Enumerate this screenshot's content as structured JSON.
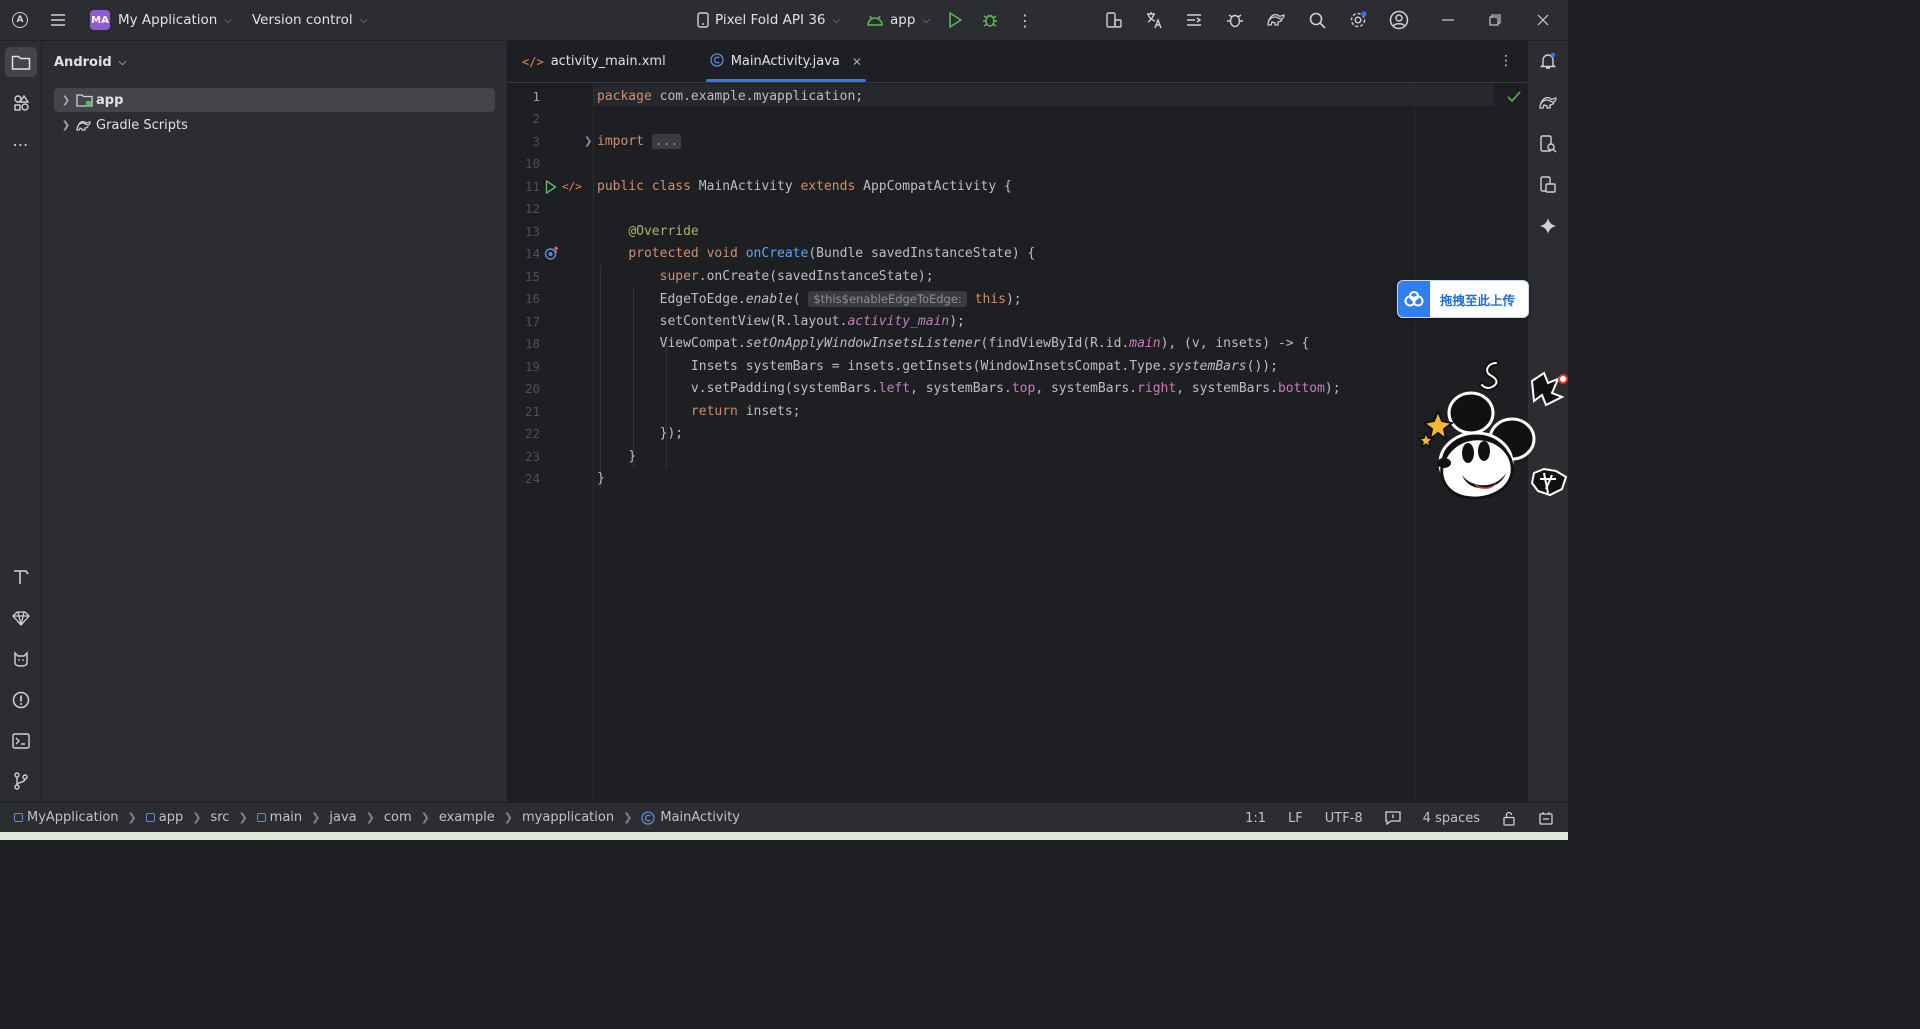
{
  "titlebar": {
    "project_badge": "MA",
    "project_name": "My Application",
    "vcs_label": "Version control",
    "device": "Pixel Fold API 36",
    "run_config": "app"
  },
  "project_panel": {
    "view_label": "Android",
    "tree": [
      {
        "label": "app"
      },
      {
        "label": "Gradle Scripts"
      }
    ]
  },
  "editor": {
    "tabs": [
      {
        "label": "activity_main.xml"
      },
      {
        "label": "MainActivity.java"
      }
    ],
    "line_numbers": [
      "1",
      "2",
      "3",
      "10",
      "11",
      "12",
      "13",
      "14",
      "15",
      "16",
      "17",
      "18",
      "19",
      "20",
      "21",
      "22",
      "23",
      "24"
    ],
    "code": {
      "l1a": "package",
      "l1b": " com.example.myapplication;",
      "l3a": "import",
      "l3b": "...",
      "l11a": "public class",
      "l11b": " MainActivity ",
      "l11c": "extends",
      "l11d": " AppCompatActivity {",
      "l13": "@Override",
      "l14a": "protected void",
      "l14b": "onCreate",
      "l14c": "(Bundle savedInstanceState) {",
      "l15a": "super",
      "l15b": ".onCreate(savedInstanceState);",
      "l16a": "EdgeToEdge.",
      "l16b": "enable",
      "l16c": "(",
      "l16hint": "$this$enableEdgeToEdge:",
      "l16d": "this",
      "l16e": ");",
      "l17a": "setContentView(R.layout.",
      "l17b": "activity_main",
      "l17c": ");",
      "l18a": "ViewCompat.",
      "l18b": "setOnApplyWindowInsetsListener",
      "l18c": "(findViewById(R.id.",
      "l18d": "main",
      "l18e": "), (v, insets) -> {",
      "l19a": "Insets systemBars = insets.getInsets(WindowInsetsCompat.Type.",
      "l19b": "systemBars",
      "l19c": "());",
      "l20a": "v.setPadding(systemBars.",
      "l20b": "left",
      "l20c": ", systemBars.",
      "l20d": "top",
      "l20e": ", systemBars.",
      "l20f": "right",
      "l20g": ", systemBars.",
      "l20h": "bottom",
      "l20i": ");",
      "l21a": "return",
      "l21b": " insets;",
      "l22": "});",
      "l23": "}",
      "l24": "}"
    }
  },
  "upload_widget": {
    "label": "拖拽至此上传"
  },
  "statusbar": {
    "breadcrumbs": [
      "MyApplication",
      "app",
      "src",
      "main",
      "java",
      "com",
      "example",
      "myapplication",
      "MainActivity"
    ],
    "position": "1:1",
    "line_sep": "LF",
    "encoding": "UTF-8",
    "indent": "4 spaces"
  },
  "colors": {
    "accent": "#3574f0",
    "keyword": "#cf8e6d",
    "function": "#56a8f5",
    "annotation": "#b3ae60",
    "field": "#c77dbb"
  }
}
